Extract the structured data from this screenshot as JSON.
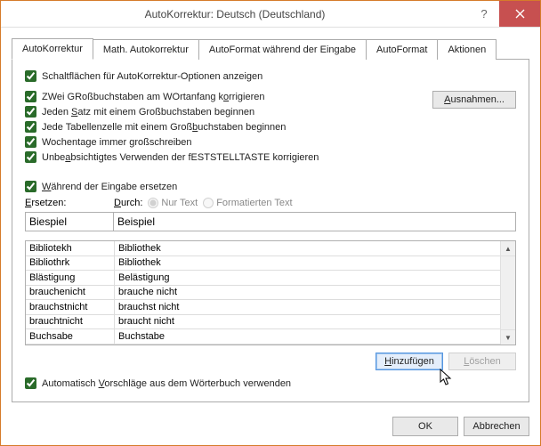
{
  "titlebar": {
    "title": "AutoKorrektur: Deutsch (Deutschland)"
  },
  "tabs": {
    "t0": "AutoKorrektur",
    "t1": "Math. Autokorrektur",
    "t2": "AutoFormat während der Eingabe",
    "t3": "AutoFormat",
    "t4": "Aktionen"
  },
  "options": {
    "show_buttons": "Schaltflächen für AutoKorrektur-Optionen anzeigen",
    "two_caps_pre": "ZWei GRoßbuchstaben am WOrtanfang k",
    "two_caps_post": "rrigieren",
    "cap_sentence_pre": "Jeden ",
    "cap_sentence_mid": "atz mit einem Großbuchstaben beginnen",
    "cap_sentence_u": "S",
    "cap_cell_pre": "Jede Tabellenzelle mit einem Groß",
    "cap_cell_u": "b",
    "cap_cell_post": "uchstaben beginnen",
    "weekdays": "Wochentage immer großschreiben",
    "capslock_pre": "Unbe",
    "capslock_u": "a",
    "capslock_post": "bsichtigtes Verwenden der fESTSTELLTASTE korrigieren",
    "replace_typing_pre": "",
    "replace_typing_u": "W",
    "replace_typing_post": "ährend der Eingabe ersetzen",
    "auto_dict_pre": "Automatisch ",
    "auto_dict_u": "V",
    "auto_dict_post": "orschläge aus dem Wörterbuch verwenden"
  },
  "buttons": {
    "exceptions_u": "A",
    "exceptions_post": "usnahmen...",
    "add_u": "H",
    "add_post": "inzufügen",
    "delete_u": "L",
    "delete_post": "öschen",
    "ok": "OK",
    "cancel": "Abbrechen"
  },
  "replace": {
    "label_replace_u": "E",
    "label_replace_post": "rsetzen:",
    "label_with_u": "D",
    "label_with_post": "urch:",
    "plain_text": "Nur Text",
    "formatted_text": "Formatierten Text",
    "input_replace": "Biespiel",
    "input_with": "Beispiel"
  },
  "list": [
    {
      "a": "Bibliotekh",
      "b": "Bibliothek"
    },
    {
      "a": "Bibliothrk",
      "b": "Bibliothek"
    },
    {
      "a": "Blästigung",
      "b": "Belästigung"
    },
    {
      "a": "brauchenicht",
      "b": "brauche nicht"
    },
    {
      "a": "brauchstnicht",
      "b": "brauchst nicht"
    },
    {
      "a": "brauchtnicht",
      "b": "braucht nicht"
    },
    {
      "a": "Buchsabe",
      "b": "Buchstabe"
    }
  ]
}
